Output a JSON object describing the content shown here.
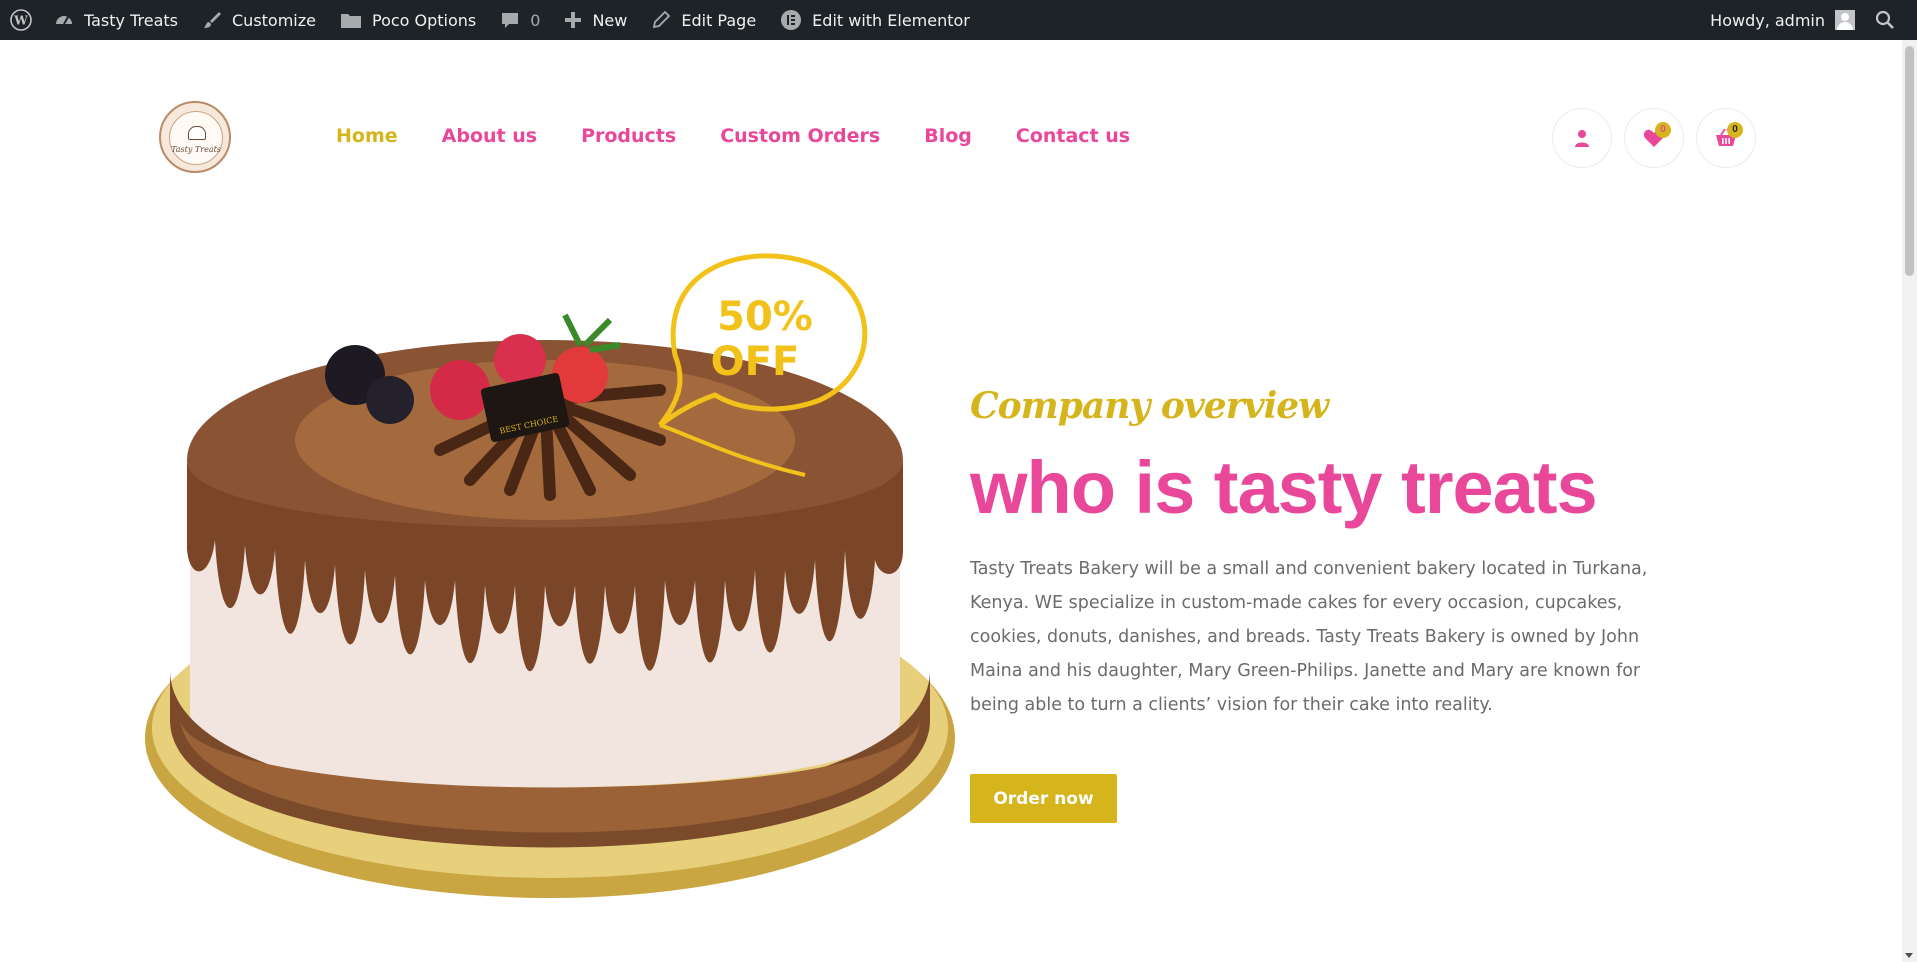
{
  "adminbar": {
    "site_name": "Tasty Treats",
    "customize": "Customize",
    "poco_options": "Poco Options",
    "comments_count": "0",
    "new": "New",
    "edit_page": "Edit Page",
    "edit_elementor": "Edit with Elementor",
    "howdy": "Howdy, admin",
    "icons": [
      "wordpress-logo-icon",
      "dashboard-icon",
      "paintbrush-icon",
      "folder-icon",
      "comment-icon",
      "plus-icon",
      "pencil-icon",
      "elementor-icon",
      "avatar-icon",
      "search-icon"
    ]
  },
  "header": {
    "logo_text": "Tasty Treats",
    "nav": [
      {
        "label": "Home",
        "active": true
      },
      {
        "label": "About us",
        "active": false
      },
      {
        "label": "Products",
        "active": false
      },
      {
        "label": "Custom Orders",
        "active": false
      },
      {
        "label": "Blog",
        "active": false
      },
      {
        "label": "Contact us",
        "active": false
      }
    ],
    "wishlist_count": "0",
    "cart_count": "0"
  },
  "hero": {
    "badge_line1": "50%",
    "badge_line2": "OFF",
    "cake_plaque": "BEST CHOICE",
    "overview": "Company overview",
    "title": "who is tasty treats",
    "description": "Tasty Treats Bakery will be a small and convenient bakery located in Turkana, Kenya. WE  specialize in custom-made cakes for every occasion, cupcakes, cookies, donuts, danishes, and breads. Tasty Treats Bakery is owned by John Maina and his daughter, Mary Green-Philips. Janette and Mary are known for being able to turn a clients’ vision for their cake into reality.",
    "button": "Order now"
  },
  "colors": {
    "adminbar_bg": "#1d2327",
    "brand_pink": "#e8479a",
    "brand_gold": "#d6b41b",
    "body_text": "#6b6b6b"
  }
}
